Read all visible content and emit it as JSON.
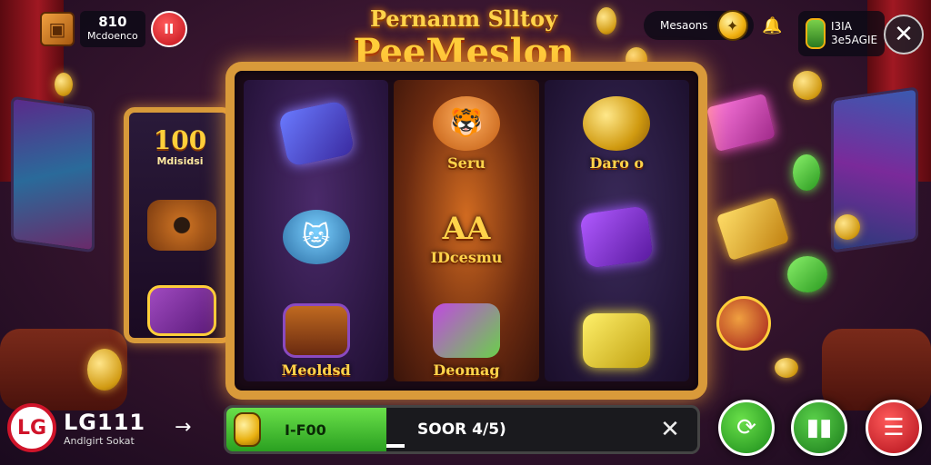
{
  "top_left": {
    "counter_value": "810",
    "counter_label": "Mcdoenco",
    "pause_label": "II"
  },
  "title": {
    "line1": "Pernanm Slltoy",
    "line2": "PeeMeslon"
  },
  "top_right": {
    "messages_label": "Mesaons",
    "bonus_line1": "I3IA",
    "bonus_line2": "3e5AGIE"
  },
  "side_reel": {
    "jackpot_value": "100",
    "jackpot_label": "Mdisidsi"
  },
  "reels": {
    "reel1": {
      "bottom_label": "Meoldsd"
    },
    "reel2": {
      "top_label": "Seru",
      "mid_big": "AA",
      "mid_label": "IDcesmu",
      "bottom_label": "Deomag"
    },
    "reel3": {
      "top_label": "Daro o"
    }
  },
  "brand": {
    "logo": "LG",
    "name": "LG111",
    "tagline": "Andlgirt Sokat"
  },
  "bet_bar": {
    "amount": "I-F00",
    "info": "SOOR 4/5)"
  },
  "colors": {
    "frame_gold": "#d99a3a",
    "accent_green": "#2aa020",
    "accent_red": "#c0101a"
  }
}
